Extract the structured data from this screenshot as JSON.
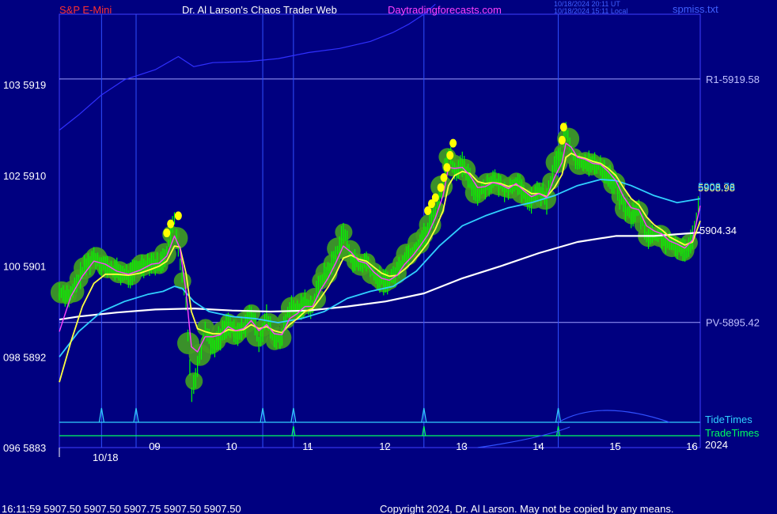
{
  "header": {
    "symbol": "S&P E-Mini",
    "title": "Dr. Al Larson's Chaos Trader Web",
    "site": "Daytradingforecasts.com",
    "timestamp_utc": "10/18/2024 20:11 UT",
    "timestamp_local": "10/18/2024 15:11 Local",
    "file": "spmiss.txt"
  },
  "footer": {
    "quote": "16:11:59  5907.50  5907.50  5907.75  5907.50  5907.50",
    "copyright": "Copyright 2024, Dr. Al Larson. May not be copied by any means."
  },
  "colors": {
    "background": "#000080",
    "axis": "#4040ff",
    "title_red": "#ff3030",
    "title_white": "#ffffff",
    "site_magenta": "#ff40ff",
    "price": "#00ff00",
    "fast_ma": "#ff40ff",
    "mid_ma": "#ffff40",
    "slow_ma": "#30d0ff",
    "vwap": "#ffffff",
    "envelope": "#3030ff",
    "tide": "#30d0ff",
    "trade": "#00ff60",
    "level_line": "#a0a0ff",
    "dot_yellow": "#ffff00",
    "glow": "#40a020"
  },
  "chart_data": {
    "type": "line",
    "title": "S&P E-Mini",
    "y_axis": {
      "range": [
        5883,
        5926
      ],
      "ticks": [
        {
          "value": 5919,
          "label": "103  5919"
        },
        {
          "value": 5910,
          "label": "102  5910"
        },
        {
          "value": 5901,
          "label": "100  5901"
        },
        {
          "value": 5892,
          "label": "098  5892"
        },
        {
          "value": 5883,
          "label": "096  5883"
        }
      ]
    },
    "x_axis": {
      "unit": "hour",
      "range": [
        7.75,
        16.1
      ],
      "ticks": [
        {
          "value": 9,
          "label": "09"
        },
        {
          "value": 10,
          "label": "10"
        },
        {
          "value": 11,
          "label": "11"
        },
        {
          "value": 12,
          "label": "12"
        },
        {
          "value": 13,
          "label": "13"
        },
        {
          "value": 14,
          "label": "14"
        },
        {
          "value": 15,
          "label": "15"
        },
        {
          "value": 16,
          "label": "16"
        }
      ],
      "date_label": "10/18",
      "year_label": "2024"
    },
    "levels": [
      {
        "name": "R1",
        "value": 5919.58,
        "label": "R1-5919.58"
      },
      {
        "name": "PV",
        "value": 5895.42,
        "label": "PV-5895.42"
      }
    ],
    "last_values": [
      {
        "label": "5908.98",
        "value": 5908.98
      },
      {
        "label": "5908.76",
        "value": 5908.76
      },
      {
        "label": "5904.34",
        "value": 5904.34
      }
    ],
    "vertical_lines_hours": [
      8.3,
      8.75,
      10.4,
      10.8,
      12.5,
      14.25
    ],
    "tide_times_hours": [
      8.3,
      8.75,
      10.4,
      10.8,
      12.5,
      14.25
    ],
    "trade_times_hours": [
      10.8,
      12.5,
      14.25
    ],
    "series": [
      {
        "name": "price",
        "x": [
          7.75,
          7.9,
          8.05,
          8.2,
          8.35,
          8.5,
          8.65,
          8.8,
          8.95,
          9.05,
          9.15,
          9.25,
          9.32,
          9.4,
          9.47,
          9.55,
          9.65,
          9.75,
          9.85,
          9.95,
          10.05,
          10.15,
          10.25,
          10.35,
          10.45,
          10.55,
          10.65,
          10.75,
          10.85,
          10.95,
          11.05,
          11.15,
          11.25,
          11.35,
          11.45,
          11.55,
          11.65,
          11.75,
          11.85,
          11.95,
          12.05,
          12.15,
          12.25,
          12.35,
          12.45,
          12.55,
          12.65,
          12.75,
          12.82,
          12.9,
          13.0,
          13.1,
          13.2,
          13.3,
          13.4,
          13.5,
          13.6,
          13.7,
          13.8,
          13.9,
          14.0,
          14.1,
          14.2,
          14.3,
          14.35,
          14.42,
          14.5,
          14.6,
          14.7,
          14.8,
          14.9,
          15.0,
          15.1,
          15.2,
          15.3,
          15.4,
          15.5,
          15.6,
          15.7,
          15.8,
          15.9,
          16.0,
          16.1
        ],
        "values": [
          5898.5,
          5898,
          5900.5,
          5902,
          5901,
          5900.5,
          5900,
          5901,
          5901.5,
          5901,
          5902.5,
          5905.5,
          5901.5,
          5897,
          5888.5,
          5891,
          5895,
          5893,
          5894,
          5895.5,
          5894,
          5895,
          5896.5,
          5893.5,
          5896,
          5893.5,
          5894,
          5897,
          5896.5,
          5897.5,
          5897,
          5899.5,
          5900.5,
          5902,
          5904.5,
          5902,
          5901,
          5901.5,
          5900,
          5899.5,
          5899.5,
          5900.5,
          5902,
          5902.5,
          5903.5,
          5904.5,
          5906.5,
          5909.5,
          5912.5,
          5910.5,
          5911,
          5909.5,
          5908,
          5909,
          5909.5,
          5909,
          5908.5,
          5909.5,
          5908,
          5907.5,
          5908.5,
          5907.5,
          5911,
          5912,
          5914.5,
          5912.5,
          5911,
          5911.5,
          5911,
          5911,
          5910,
          5909,
          5907,
          5906,
          5906.5,
          5904,
          5904,
          5904,
          5903,
          5903,
          5902.5,
          5904,
          5908
        ]
      },
      {
        "name": "fast",
        "x": [
          7.75,
          7.9,
          8.05,
          8.2,
          8.35,
          8.5,
          8.65,
          8.8,
          8.95,
          9.05,
          9.15,
          9.25,
          9.32,
          9.4,
          9.47,
          9.55,
          9.65,
          9.75,
          9.85,
          9.95,
          10.05,
          10.15,
          10.25,
          10.35,
          10.45,
          10.55,
          10.65,
          10.75,
          10.85,
          10.95,
          11.05,
          11.15,
          11.25,
          11.35,
          11.45,
          11.55,
          11.65,
          11.75,
          11.85,
          11.95,
          12.05,
          12.15,
          12.25,
          12.35,
          12.45,
          12.55,
          12.65,
          12.75,
          12.82,
          12.9,
          13.0,
          13.1,
          13.2,
          13.3,
          13.4,
          13.5,
          13.6,
          13.7,
          13.8,
          13.9,
          14.0,
          14.1,
          14.2,
          14.3,
          14.35,
          14.42,
          14.5,
          14.6,
          14.7,
          14.8,
          14.9,
          15.0,
          15.1,
          15.2,
          15.3,
          15.4,
          15.5,
          15.6,
          15.7,
          15.8,
          15.9,
          16.0,
          16.1
        ],
        "values": [
          5894.5,
          5898,
          5900,
          5901.5,
          5901.2,
          5900.5,
          5900.2,
          5900.6,
          5901.2,
          5901.3,
          5902,
          5904,
          5902.8,
          5898.5,
          5893,
          5892.5,
          5894,
          5894,
          5894.2,
          5895,
          5894.6,
          5894.8,
          5895.6,
          5894.6,
          5895.2,
          5894.3,
          5894.2,
          5895.8,
          5896.3,
          5897,
          5897,
          5898.6,
          5899.8,
          5901.3,
          5903,
          5902.4,
          5901.5,
          5901.3,
          5900.4,
          5899.8,
          5899.6,
          5900.1,
          5901.2,
          5902,
          5903,
          5904.1,
          5905.8,
          5908,
          5910.8,
          5910.7,
          5910.8,
          5910,
          5908.8,
          5908.9,
          5909.3,
          5909.1,
          5908.7,
          5909.2,
          5908.5,
          5907.9,
          5908.2,
          5907.8,
          5909.8,
          5911.3,
          5913.2,
          5912.8,
          5911.8,
          5911.6,
          5911.2,
          5911.1,
          5910.4,
          5909.5,
          5907.9,
          5906.8,
          5906.6,
          5905,
          5904.5,
          5904.2,
          5903.5,
          5903.2,
          5902.8,
          5903.6,
          5907
        ]
      },
      {
        "name": "mid",
        "x": [
          7.75,
          7.9,
          8.05,
          8.2,
          8.35,
          8.5,
          8.65,
          8.8,
          8.95,
          9.05,
          9.15,
          9.25,
          9.32,
          9.4,
          9.47,
          9.55,
          9.65,
          9.75,
          9.85,
          9.95,
          10.05,
          10.15,
          10.25,
          10.35,
          10.45,
          10.55,
          10.65,
          10.75,
          10.85,
          10.95,
          11.05,
          11.15,
          11.25,
          11.35,
          11.45,
          11.55,
          11.65,
          11.75,
          11.85,
          11.95,
          12.05,
          12.15,
          12.25,
          12.35,
          12.45,
          12.55,
          12.65,
          12.75,
          12.82,
          12.9,
          13.0,
          13.1,
          13.2,
          13.3,
          13.4,
          13.5,
          13.6,
          13.7,
          13.8,
          13.9,
          14.0,
          14.1,
          14.2,
          14.3,
          14.35,
          14.42,
          14.5,
          14.6,
          14.7,
          14.8,
          14.9,
          15.0,
          15.1,
          15.2,
          15.3,
          15.4,
          15.5,
          15.6,
          15.7,
          15.8,
          15.9,
          16.0,
          16.1
        ],
        "values": [
          5889.5,
          5893.5,
          5897,
          5899.3,
          5900.2,
          5900.2,
          5900.1,
          5900.3,
          5900.7,
          5901,
          5901.5,
          5903,
          5902.9,
          5900.3,
          5896.5,
          5894.8,
          5894.5,
          5894.3,
          5894.3,
          5894.7,
          5894.6,
          5894.7,
          5895.2,
          5894.8,
          5895,
          5894.6,
          5894.4,
          5895.2,
          5895.8,
          5896.5,
          5896.8,
          5897.8,
          5898.9,
          5900.2,
          5901.8,
          5902.1,
          5901.7,
          5901.5,
          5900.9,
          5900.3,
          5900,
          5900.1,
          5900.7,
          5901.4,
          5902.3,
          5903.3,
          5904.7,
          5906.5,
          5909,
          5910,
          5910.4,
          5910.2,
          5909.4,
          5909.2,
          5909.3,
          5909.2,
          5908.9,
          5909.1,
          5908.7,
          5908.2,
          5908.2,
          5907.9,
          5908.8,
          5910.1,
          5911.8,
          5912.2,
          5911.9,
          5911.7,
          5911.4,
          5911.2,
          5910.7,
          5910,
          5908.8,
          5907.7,
          5907.1,
          5905.9,
          5905.1,
          5904.6,
          5903.9,
          5903.5,
          5903.1,
          5903.4,
          5905.5
        ]
      },
      {
        "name": "slow",
        "x": [
          7.75,
          8.0,
          8.3,
          8.6,
          8.9,
          9.1,
          9.25,
          9.35,
          9.5,
          9.7,
          10.0,
          10.3,
          10.6,
          10.9,
          11.2,
          11.5,
          11.8,
          12.1,
          12.4,
          12.7,
          13.0,
          13.3,
          13.6,
          13.9,
          14.2,
          14.5,
          14.8,
          15.0,
          15.2,
          15.5,
          15.8,
          16.1
        ],
        "values": [
          5892,
          5894.5,
          5896.5,
          5897.5,
          5898.2,
          5898.5,
          5899,
          5898.8,
          5897.5,
          5896.5,
          5896,
          5895.8,
          5895.4,
          5895.8,
          5896.5,
          5897.8,
          5898.5,
          5899,
          5900.5,
          5903,
          5905,
          5906,
          5906.8,
          5907.3,
          5908,
          5909,
          5909.6,
          5909.5,
          5909,
          5908,
          5907.3,
          5907.7
        ]
      },
      {
        "name": "vwap",
        "x": [
          7.75,
          8.0,
          8.5,
          9.0,
          9.5,
          10.0,
          10.5,
          11.0,
          11.5,
          12.0,
          12.5,
          13.0,
          13.5,
          14.0,
          14.5,
          15.0,
          15.5,
          16.1
        ],
        "values": [
          5895.7,
          5896,
          5896.4,
          5896.7,
          5896.8,
          5896.6,
          5896.5,
          5896.6,
          5897,
          5897.5,
          5898.3,
          5899.8,
          5901,
          5902.3,
          5903.4,
          5904,
          5904,
          5904.34
        ]
      },
      {
        "name": "envelope",
        "x": [
          7.75,
          8.0,
          8.3,
          8.6,
          9.0,
          9.3,
          9.5,
          9.75,
          10.2,
          10.6,
          11.0,
          11.4,
          11.8,
          12.1,
          12.3,
          12.5,
          12.65
        ],
        "values": [
          5914.5,
          5916,
          5918,
          5919.5,
          5920.5,
          5921.8,
          5920.8,
          5921.2,
          5921.3,
          5921.6,
          5922.2,
          5922.6,
          5923.3,
          5924.2,
          5925,
          5926,
          5927
        ]
      }
    ],
    "signal_dots": [
      {
        "x": 9.15,
        "y": 5904.3
      },
      {
        "x": 9.2,
        "y": 5905.2
      },
      {
        "x": 9.3,
        "y": 5906
      },
      {
        "x": 12.55,
        "y": 5906.5
      },
      {
        "x": 12.6,
        "y": 5907.2
      },
      {
        "x": 12.65,
        "y": 5907.8
      },
      {
        "x": 12.72,
        "y": 5908.8
      },
      {
        "x": 12.76,
        "y": 5909.8
      },
      {
        "x": 12.8,
        "y": 5910.8
      },
      {
        "x": 12.84,
        "y": 5912
      },
      {
        "x": 12.88,
        "y": 5913.2
      },
      {
        "x": 14.3,
        "y": 5913.5
      },
      {
        "x": 14.32,
        "y": 5914.8
      }
    ],
    "legend": [
      "TideTimes",
      "TradeTimes"
    ]
  }
}
